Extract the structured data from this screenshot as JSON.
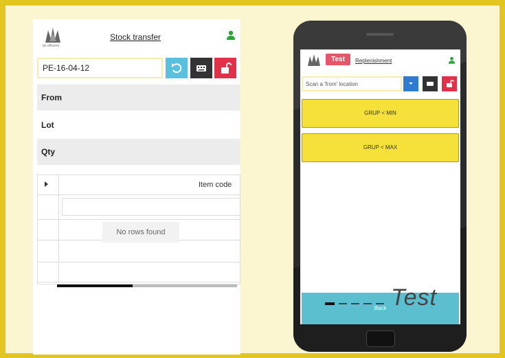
{
  "transfer_panel": {
    "title": "Stock transfer",
    "logo_text": "be efficient",
    "code_value": "PE-16-04-12",
    "fields": {
      "from": "From",
      "lot": "Lot",
      "qty": "Qty"
    },
    "grid": {
      "column": "Item code",
      "empty_text": "No rows found"
    },
    "icons": {
      "user": "user-icon",
      "undo": "undo-icon",
      "keyboard": "keyboard-icon",
      "lock": "unlock-icon"
    }
  },
  "phone_screen": {
    "badge": "Test",
    "title": "Replenishment",
    "scan_placeholder": "Scan a 'from' location",
    "tiles": [
      "GRUP < MIN",
      "GRUP < MAX"
    ],
    "back_label": "Back",
    "watermark": "Test",
    "icons": {
      "user": "user-icon",
      "dropdown": "chevron-down-icon",
      "keyboard": "keyboard-icon",
      "lock": "unlock-icon"
    }
  },
  "colors": {
    "background": "#e3c51f",
    "undo_button": "#5bc0de",
    "keyboard_button": "#333333",
    "lock_button": "#e03148",
    "tile_yellow": "#f6e03a",
    "back_button": "#5bbfd0",
    "badge": "#e4576a",
    "dropdown_button": "#2e7bcf"
  }
}
